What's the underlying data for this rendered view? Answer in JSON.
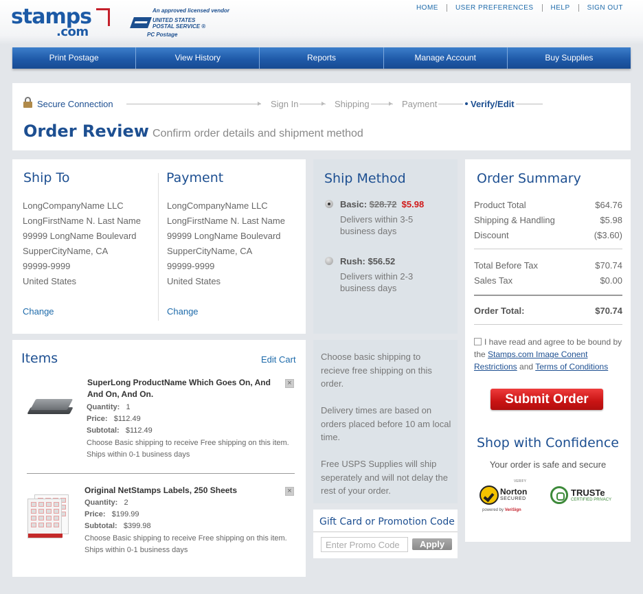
{
  "header": {
    "logo_main": "stamps",
    "logo_suffix": ".com",
    "vendor_note": "An approved licensed vendor",
    "usps_line1": "UNITED STATES",
    "usps_line2": "POSTAL SERVICE ®",
    "usps_line3": "PC Postage",
    "links": [
      "HOME",
      "USER PREFERENCES",
      "HELP",
      "SIGN OUT"
    ]
  },
  "nav": {
    "tabs": [
      "Print Postage",
      "View History",
      "Reports",
      "Manage Account",
      "Buy Supplies"
    ]
  },
  "progress": {
    "secure": "Secure Connection",
    "steps": [
      "Sign In",
      "Shipping",
      "Payment"
    ],
    "current": "Verify/Edit",
    "title": "Order Review",
    "subtitle": "Confirm order details and shipment method"
  },
  "ship_to": {
    "heading": "Ship To",
    "lines": [
      "LongCompanyName LLC",
      "LongFirstName N. Last Name",
      "99999 LongName Boulevard",
      "SupperCityName, CA",
      "99999-9999",
      "United States"
    ],
    "change": "Change"
  },
  "payment": {
    "heading": "Payment",
    "lines": [
      "LongCompanyName LLC",
      "LongFirstName N. Last Name",
      "99999 LongName Boulevard",
      "SupperCityName, CA",
      "99999-9999",
      "United States"
    ],
    "change": "Change"
  },
  "ship_method": {
    "heading": "Ship Method",
    "basic_label": "Basic:",
    "basic_old_price": "$28.72",
    "basic_price": "$5.98",
    "basic_desc": "Delivers within 3-5 business days",
    "rush_label": "Rush:",
    "rush_price": "$56.52",
    "rush_desc": "Delivers within 2-3 business days",
    "selected": "basic"
  },
  "summary": {
    "heading": "Order Summary",
    "rows": [
      {
        "label": "Product Total",
        "value": "$64.76"
      },
      {
        "label": "Shipping & Handling",
        "value": "$5.98"
      },
      {
        "label": "Discount",
        "value": "($3.60)"
      },
      {
        "label": "Total Before Tax",
        "value": "$70.74"
      },
      {
        "label": "Sales Tax",
        "value": "$0.00"
      }
    ],
    "total_label": "Order Total:",
    "total_value": "$70.74",
    "agree_text": "I have read and agree to be bound by the",
    "agree_link1": "Stamps.com Image Conent Restrictions",
    "agree_and": "and",
    "agree_link2": "Terms of Conditions",
    "submit": "Submit Order",
    "confidence": "Shop with Confidence",
    "safe": "Your order is safe and secure",
    "norton_verify": "VERIFY",
    "norton_name": "Norton",
    "norton_secured": "SECURED",
    "norton_powered": "powered by",
    "norton_verisign": "VeriSign",
    "truste_name": "TRUSTe",
    "truste_sub": "CERTIFIED PRIVACY"
  },
  "items": {
    "heading": "Items",
    "edit": "Edit Cart",
    "list": [
      {
        "name_line1": "SuperLong ProductName Which Goes On, And",
        "name_line2": "And On, And On.",
        "quantity_label": "Quantity:",
        "quantity": "1",
        "price_label": "Price:",
        "price": "$112.49",
        "subtotal_label": "Subtotal:",
        "subtotal": "$112.49",
        "note": "Choose Basic shipping to receive Free shipping on this item. Ships within 0-1 business days"
      },
      {
        "name_line1": "Original NetStamps Labels, 250 Sheets",
        "quantity_label": "Quantity:",
        "quantity": "2",
        "price_label": "Price:",
        "price": "$199.99",
        "subtotal_label": "Subtotal:",
        "subtotal": "$399.98",
        "note": "Choose Basic shipping to receive Free shipping on this item. Ships within 0-1 business days"
      }
    ]
  },
  "promo": {
    "p1": "Choose basic shipping to recieve free shipping on this order.",
    "p2": "Delivery times are based on orders placed before 10 am local time.",
    "p3": "Free USPS Supplies will ship seperately and will not delay the rest of your order."
  },
  "gift": {
    "heading": "Gift Card or Promotion Code",
    "placeholder": "Enter Promo Code",
    "apply": "Apply"
  },
  "colors": {
    "brand_blue": "#1d4f91",
    "nav_blue": "#1f5aa9",
    "submit_red": "#c91414",
    "price_red": "#d11a1a"
  }
}
